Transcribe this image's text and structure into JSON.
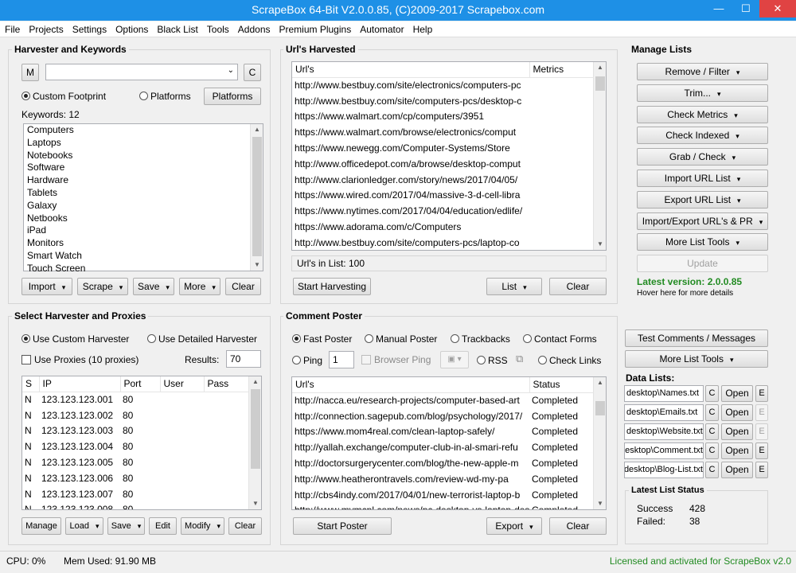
{
  "window": {
    "title": "ScrapeBox 64-Bit V2.0.0.85, (C)2009-2017 Scrapebox.com",
    "minimize": "—",
    "maximize": "☐",
    "close": "✕"
  },
  "menu": [
    "File",
    "Projects",
    "Settings",
    "Options",
    "Black List",
    "Tools",
    "Addons",
    "Premium Plugins",
    "Automator",
    "Help"
  ],
  "harvester": {
    "title": "Harvester and Keywords",
    "m_button": "M",
    "footprint_value": "",
    "c_button": "C",
    "custom_footprint": "Custom Footprint",
    "platforms_radio": "Platforms",
    "platforms_button": "Platforms",
    "keywords_count": "Keywords:  12",
    "keywords": [
      "Computers",
      "Laptops",
      "Notebooks",
      "Software",
      "Hardware",
      "Tablets",
      "Galaxy",
      "Netbooks",
      "iPad",
      "Monitors",
      "Smart Watch",
      "Touch Screen"
    ],
    "buttons": {
      "import": "Import",
      "scrape": "Scrape",
      "save": "Save",
      "more": "More",
      "clear": "Clear"
    }
  },
  "urls": {
    "title": "Url's Harvested",
    "col_urls": "Url's",
    "col_metrics": "Metrics",
    "rows": [
      "http://www.bestbuy.com/site/electronics/computers-pc",
      "http://www.bestbuy.com/site/computers-pcs/desktop-c",
      "https://www.walmart.com/cp/computers/3951",
      "https://www.walmart.com/browse/electronics/comput",
      "https://www.newegg.com/Computer-Systems/Store",
      "http://www.officedepot.com/a/browse/desktop-comput",
      "http://www.clarionledger.com/story/news/2017/04/05/",
      "https://www.wired.com/2017/04/massive-3-d-cell-libra",
      "https://www.nytimes.com/2017/04/04/education/edlife/",
      "https://www.adorama.com/c/Computers",
      "http://www.bestbuy.com/site/computers-pcs/laptop-co"
    ],
    "count": "Url's in List:  100",
    "start": "Start Harvesting",
    "list": "List",
    "clear": "Clear"
  },
  "manage": {
    "title": "Manage Lists",
    "buttons": [
      "Remove / Filter",
      "Trim...",
      "Check Metrics",
      "Check Indexed",
      "Grab / Check",
      "Import URL List",
      "Export URL List",
      "Import/Export URL's & PR",
      "More List Tools"
    ],
    "update": "Update",
    "latest": "Latest version:  2.0.0.85",
    "hover": "Hover here for more details"
  },
  "proxies": {
    "title": "Select Harvester and Proxies",
    "custom": "Use Custom Harvester",
    "detailed": "Use Detailed Harvester",
    "use_proxies": "Use Proxies  (10 proxies)",
    "results_label": "Results:",
    "results_value": "70",
    "headers": [
      "S",
      "IP",
      "Port",
      "User",
      "Pass"
    ],
    "rows": [
      [
        "N",
        "123.123.123.001",
        "80"
      ],
      [
        "N",
        "123.123.123.002",
        "80"
      ],
      [
        "N",
        "123.123.123.003",
        "80"
      ],
      [
        "N",
        "123.123.123.004",
        "80"
      ],
      [
        "N",
        "123.123.123.005",
        "80"
      ],
      [
        "N",
        "123.123.123.006",
        "80"
      ],
      [
        "N",
        "123.123.123.007",
        "80"
      ],
      [
        "N",
        "123.123.123.008",
        "80"
      ]
    ],
    "buttons": {
      "manage": "Manage",
      "load": "Load",
      "save": "Save",
      "edit": "Edit",
      "modify": "Modify",
      "clear": "Clear"
    }
  },
  "comment": {
    "title": "Comment Poster",
    "modes": [
      "Fast Poster",
      "Manual Poster",
      "Trackbacks",
      "Contact Forms"
    ],
    "ping": "Ping",
    "ping_value": "1",
    "browser_ping": "Browser Ping",
    "rss": "RSS",
    "check_links": "Check Links",
    "col_urls": "Url's",
    "col_status": "Status",
    "rows": [
      [
        "http://nacca.eu/research-projects/computer-based-art",
        "Completed"
      ],
      [
        "http://connection.sagepub.com/blog/psychology/2017/",
        "Completed"
      ],
      [
        "https://www.mom4real.com/clean-laptop-safely/",
        "Completed"
      ],
      [
        "http://yallah.exchange/computer-club-in-al-smari-refu",
        "Completed"
      ],
      [
        "http://doctorsurgerycenter.com/blog/the-new-apple-m",
        "Completed"
      ],
      [
        "http://www.heatherontravels.com/review-wd-my-pa",
        "Completed"
      ],
      [
        "http://cbs4indy.com/2017/04/01/new-terrorist-laptop-b",
        "Completed"
      ],
      [
        "http://www.mymcpl.com/news/pc-desktop-vs-laptop-desk",
        "Completed"
      ]
    ],
    "start": "Start Poster",
    "export": "Export",
    "clear": "Clear"
  },
  "side": {
    "test": "Test Comments / Messages",
    "more": "More List Tools",
    "data_lists": "Data Lists:",
    "files": [
      {
        "name": "desktop\\Names.txt",
        "c": "C",
        "open": "Open",
        "e": "E",
        "e_enabled": true
      },
      {
        "name": "desktop\\Emails.txt",
        "c": "C",
        "open": "Open",
        "e": "E",
        "e_enabled": false
      },
      {
        "name": "desktop\\Website.txt",
        "c": "C",
        "open": "Open",
        "e": "E",
        "e_enabled": false
      },
      {
        "name": "desktop\\Comment.txt",
        "c": "C",
        "open": "Open",
        "e": "E",
        "e_enabled": true
      },
      {
        "name": "desktop\\Blog-List.txt",
        "c": "C",
        "open": "Open",
        "e": "E",
        "e_enabled": true
      }
    ],
    "status_title": "Latest List Status",
    "success_label": "Success",
    "success_value": "428",
    "failed_label": "Failed:",
    "failed_value": "38"
  },
  "status": {
    "cpu": "CPU:  0%",
    "mem": "Mem Used:  91.90 MB",
    "license": "Licensed and activated for ScrapeBox v2.0"
  },
  "colors": {
    "titlebar": "#1e90e6",
    "close": "#e04343",
    "green": "#228b22"
  }
}
